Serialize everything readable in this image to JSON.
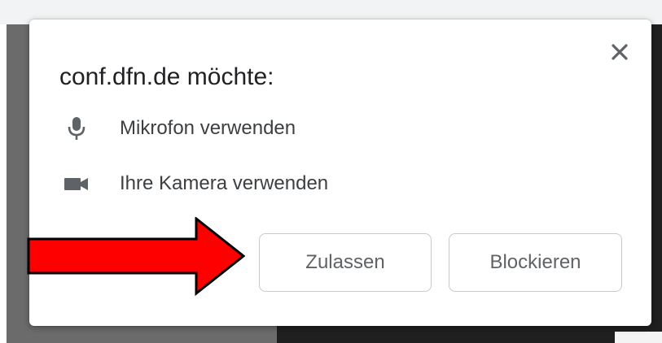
{
  "dialog": {
    "title": "conf.dfn.de möchte:",
    "close_icon": "close-icon",
    "permissions": [
      {
        "icon": "microphone-icon",
        "label": "Mikrofon verwenden"
      },
      {
        "icon": "camera-icon",
        "label": "Ihre Kamera verwenden"
      }
    ],
    "buttons": {
      "allow": "Zulassen",
      "block": "Blockieren"
    }
  },
  "annotation": {
    "arrow_icon": "red-arrow-icon",
    "arrow_color": "#ff0000"
  },
  "colors": {
    "title_text": "#202124",
    "body_text": "#3c4043",
    "button_text": "#5f6368",
    "icon": "#5f6368",
    "button_border": "#c7c9cc"
  }
}
